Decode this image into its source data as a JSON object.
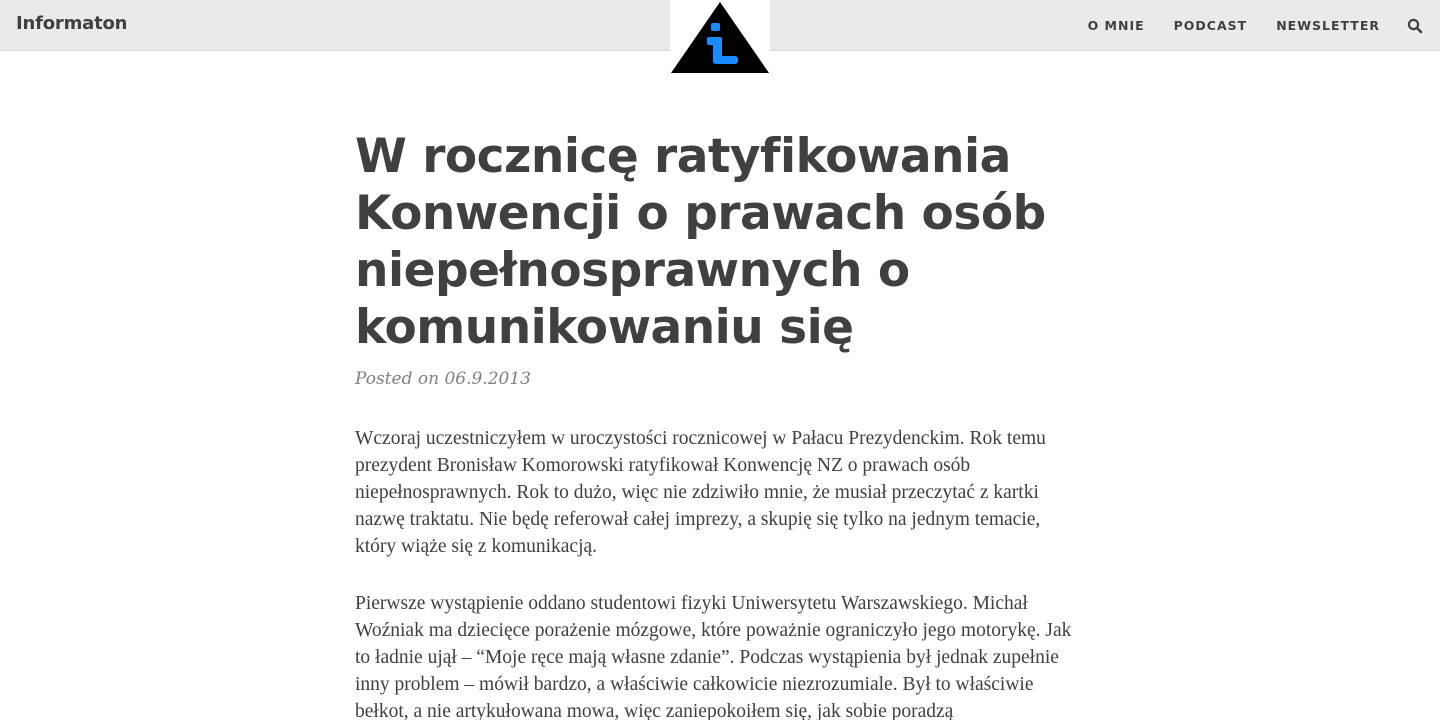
{
  "header": {
    "brand": "Informaton",
    "logo": {
      "icon": "info-triangle-icon",
      "triangle_color": "#000000",
      "letter_color": "#1a8cff"
    },
    "nav": [
      {
        "label": "O MNIE"
      },
      {
        "label": "PODCAST"
      },
      {
        "label": "NEWSLETTER"
      }
    ],
    "search_icon": "search-icon"
  },
  "article": {
    "title": "W rocznicę ratyfikowania Konwencji o prawach osób niepełnosprawnych o komunikowaniu się",
    "meta": "Posted on 06.9.2013",
    "paragraphs": [
      "Wczoraj uczestniczyłem w uroczystości rocznicowej w Pałacu Prezydenckim. Rok temu prezydent Bronisław Komorowski ratyfikował Konwencję NZ o prawach osób niepełnosprawnych. Rok to dużo, więc nie zdziwiło mnie, że musiał przeczytać z kartki nazwę traktatu. Nie będę referował całej imprezy, a skupię się tylko na jednym temacie, który wiąże się z komunikacją.",
      "Pierwsze wystąpienie oddano studentowi fizyki Uniwersytetu Warszawskiego. Michał Woźniak ma dziecięce porażenie mózgowe, które poważnie ograniczyło jego motorykę. Jak to ładnie ujął – “Moje ręce mają własne zdanie”. Podczas wystąpienia był jednak zupełnie inny problem – mówił bardzo, a właściwie całkowicie niezrozumiale. Był to właściwie bełkot, a nie artykułowana mowa, więc zaniepokoiłem się, jak sobie poradzą"
    ]
  },
  "colors": {
    "topbar_bg": "#eaeaea",
    "text": "#404040",
    "meta": "#808080",
    "accent": "#1a8cff"
  }
}
